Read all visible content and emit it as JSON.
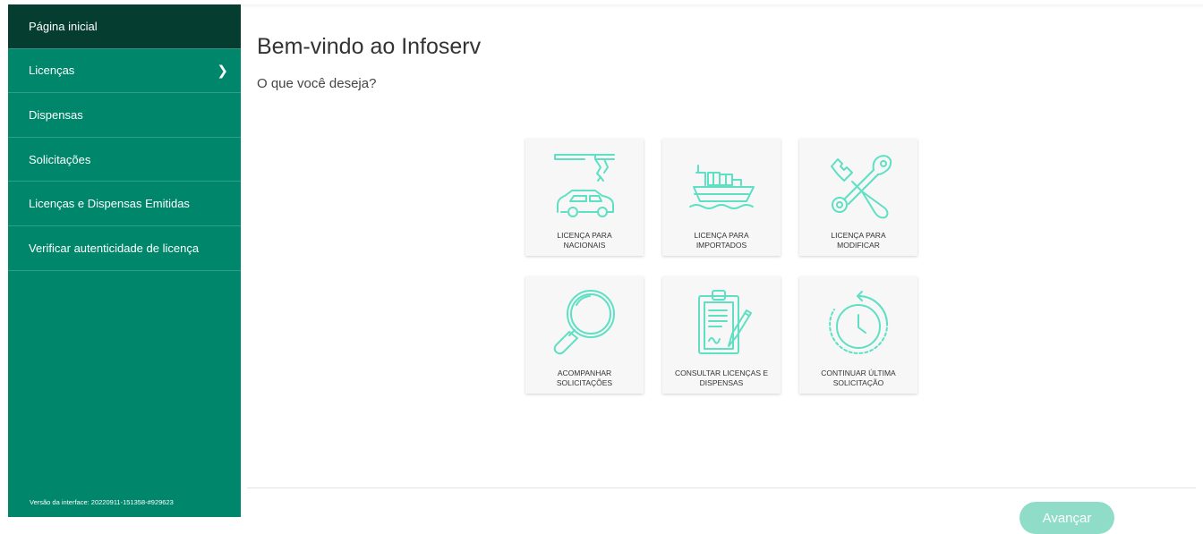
{
  "sidebar": {
    "items": [
      {
        "label": "Página inicial"
      },
      {
        "label": "Licenças"
      },
      {
        "label": "Dispensas"
      },
      {
        "label": "Solicitações"
      },
      {
        "label": "Licenças e Dispensas Emitidas"
      },
      {
        "label": "Verificar autenticidade de licença"
      }
    ],
    "version": "Versão da interface: 20220911-151358-#929623"
  },
  "main": {
    "title": "Bem-vindo ao Infoserv",
    "subtitle": "O que você deseja?",
    "cards": [
      {
        "line1": "LICENÇA PARA",
        "line2": "NACIONAIS",
        "icon": "car-assembly-icon"
      },
      {
        "line1": "LICENÇA PARA",
        "line2": "IMPORTADOS",
        "icon": "cargo-ship-icon"
      },
      {
        "line1": "LICENÇA PARA",
        "line2": "MODIFICAR",
        "icon": "wrench-tools-icon"
      },
      {
        "line1": "ACOMPANHAR",
        "line2": "SOLICITAÇÕES",
        "icon": "magnifier-icon"
      },
      {
        "line1": "CONSULTAR LICENÇAS E",
        "line2": "DISPENSAS",
        "icon": "clipboard-icon"
      },
      {
        "line1": "CONTINUAR ÚLTIMA",
        "line2": "SOLICITAÇÃO",
        "icon": "clock-history-icon"
      }
    ],
    "next_label": "Avançar"
  },
  "colors": {
    "sidebar": "#00866b",
    "sidebar_active": "#053d31",
    "icon_accent": "#5fe0c4",
    "button": "#8fdcc8"
  }
}
